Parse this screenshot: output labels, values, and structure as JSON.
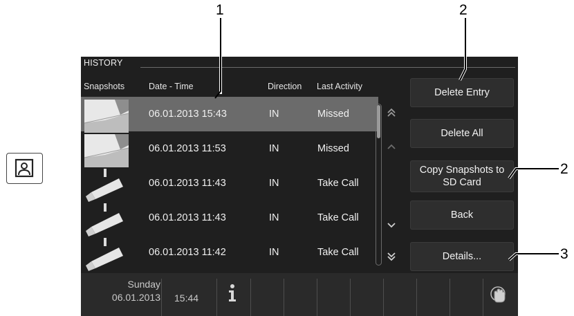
{
  "callouts": {
    "c1": "1",
    "c2a": "2",
    "c2b": "2",
    "c3": "3"
  },
  "screen": {
    "title": "HISTORY",
    "headers": {
      "snapshots": "Snapshots",
      "date_time": "Date - Time",
      "direction": "Direction",
      "last_activity": "Last Activity"
    },
    "rows": [
      {
        "date_time": "06.01.2013 15:43",
        "direction": "IN",
        "activity": "Missed",
        "snapshot": "photo",
        "selected": true
      },
      {
        "date_time": "06.01.2013 11:53",
        "direction": "IN",
        "activity": "Missed",
        "snapshot": "photo",
        "selected": false
      },
      {
        "date_time": "06.01.2013 11:43",
        "direction": "IN",
        "activity": "Take Call",
        "snapshot": "camera-icon",
        "selected": false
      },
      {
        "date_time": "06.01.2013 11:43",
        "direction": "IN",
        "activity": "Take Call",
        "snapshot": "camera-icon",
        "selected": false
      },
      {
        "date_time": "06.01.2013 11:42",
        "direction": "IN",
        "activity": "Take Call",
        "snapshot": "camera-icon",
        "selected": false
      }
    ],
    "buttons": {
      "delete_entry": "Delete Entry",
      "delete_all": "Delete All",
      "copy_line1": "Copy Snapshots to",
      "copy_line2": "SD Card",
      "back": "Back",
      "details": "Details..."
    },
    "status": {
      "day": "Sunday",
      "date": "06.01.2013",
      "time": "15:44"
    }
  },
  "icons": [
    "monitor-user-icon",
    "double-chevron-up-icon",
    "chevron-up-icon",
    "chevron-down-icon",
    "double-chevron-down-icon",
    "info-icon",
    "hand-touch-icon"
  ]
}
